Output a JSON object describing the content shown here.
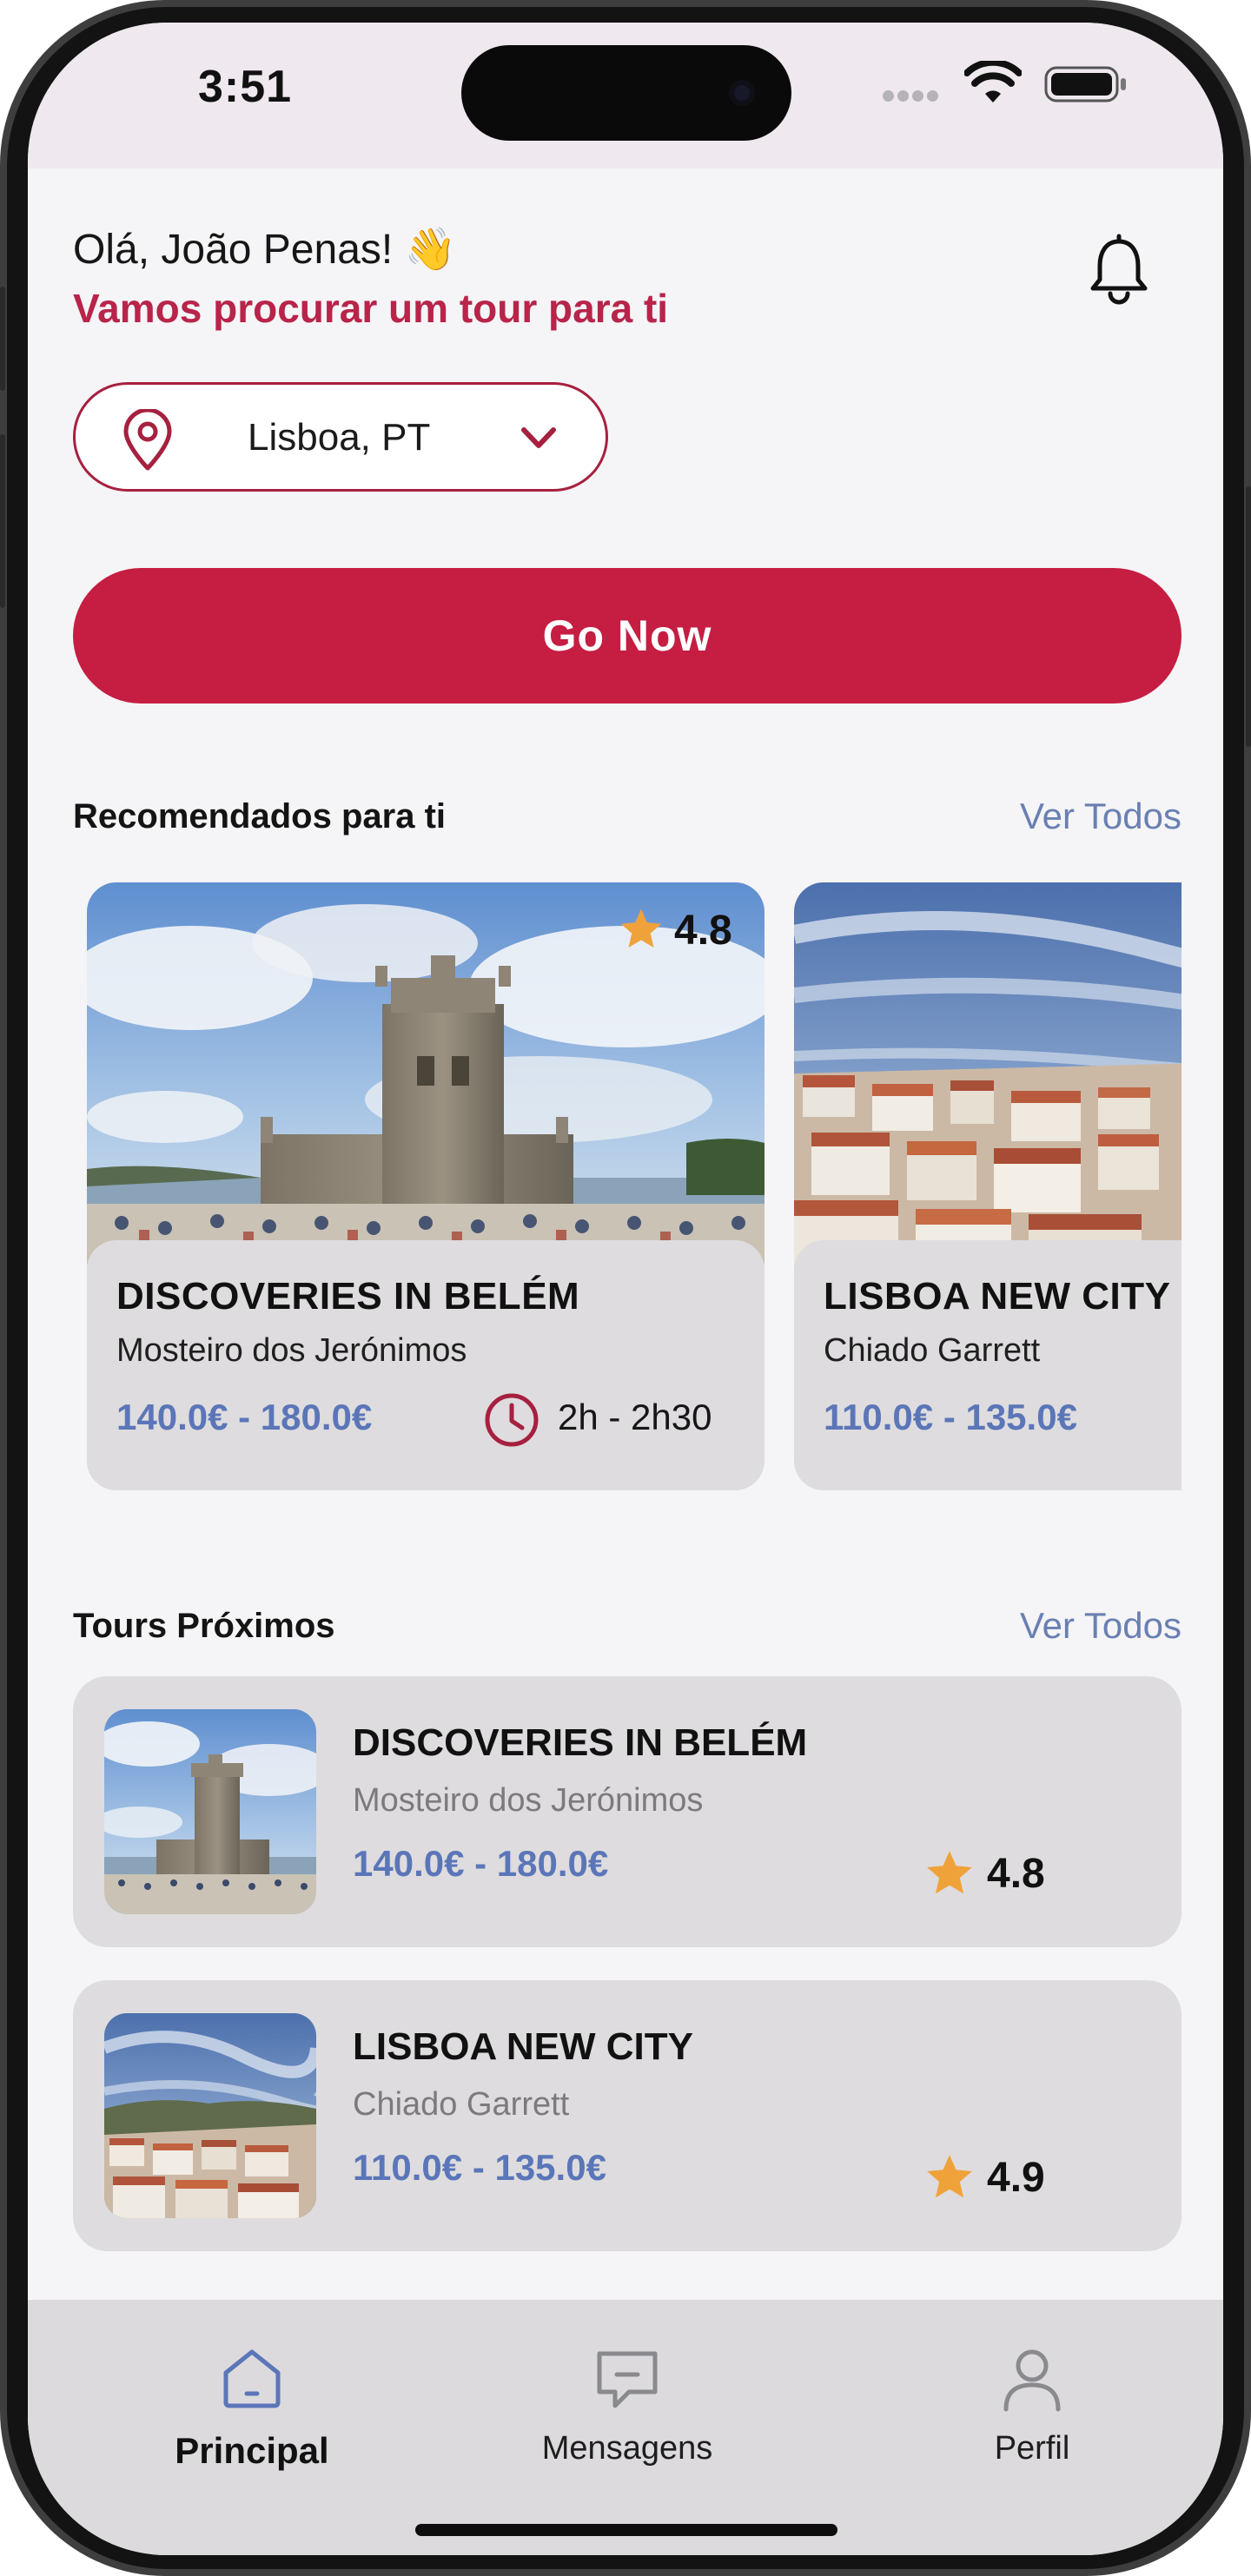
{
  "status_bar": {
    "time": "3:51"
  },
  "header": {
    "greeting": "Olá, João Penas! 👋",
    "subtitle": "Vamos procurar um tour para ti",
    "notification_icon": "bell-icon"
  },
  "location": {
    "value": "Lisboa, PT",
    "icon": "map-pin-icon"
  },
  "cta": {
    "label": "Go Now"
  },
  "recommended": {
    "title": "Recomendados para ti",
    "see_all": "Ver Todos",
    "cards": [
      {
        "title": "DISCOVERIES IN BELÉM",
        "subtitle": "Mosteiro dos Jerónimos",
        "price": "140.0€ - 180.0€",
        "duration": "2h - 2h30",
        "rating": "4.8"
      },
      {
        "title": "LISBOA NEW CITY",
        "subtitle": "Chiado Garrett",
        "price": "110.0€ - 135.0€"
      }
    ]
  },
  "nearby": {
    "title": "Tours Próximos",
    "see_all": "Ver Todos",
    "items": [
      {
        "title": "DISCOVERIES IN BELÉM",
        "subtitle": "Mosteiro dos Jerónimos",
        "price": "140.0€ - 180.0€",
        "rating": "4.8"
      },
      {
        "title": "LISBOA NEW CITY",
        "subtitle": "Chiado Garrett",
        "price": "110.0€ - 135.0€",
        "rating": "4.9"
      }
    ]
  },
  "tab_bar": {
    "tabs": [
      {
        "label": "Principal",
        "icon": "home-icon",
        "active": true
      },
      {
        "label": "Mensagens",
        "icon": "message-icon",
        "active": false
      },
      {
        "label": "Perfil",
        "icon": "user-icon",
        "active": false
      }
    ]
  },
  "colors": {
    "accent": "#c61d42",
    "price": "#5b76b8",
    "link": "#6a80b3",
    "star": "#f0a23a",
    "tab_active": "#5b76b8"
  }
}
